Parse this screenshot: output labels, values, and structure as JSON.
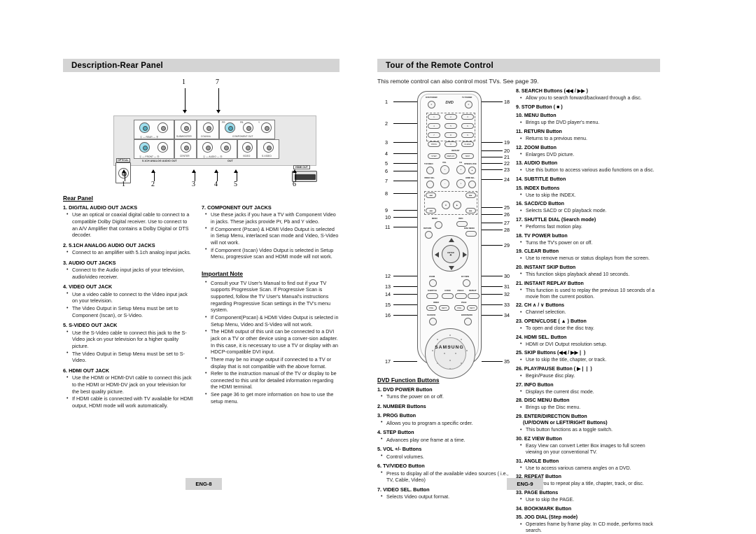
{
  "left_page": {
    "section_title": "Description-Rear Panel",
    "figure": {
      "top_callouts": [
        "1",
        "7"
      ],
      "bottom_callouts": [
        "1",
        "2",
        "3",
        "4",
        "5",
        "6"
      ],
      "panel_labels": {
        "optical": "OPTICAL",
        "rear": "Ⓛ — REAR — Ⓡ",
        "subwoofer": "SUBWOOFER",
        "coaxial": "COAXIAL",
        "component_out": "COMPONENT OUT",
        "component_pr": "PR",
        "component_pb": "PB",
        "component_y": "Y",
        "front": "Ⓛ — FRONT — Ⓡ",
        "center": "CENTER",
        "audio": "Ⓛ — AUDIO — Ⓡ",
        "video": "VIDEO",
        "svideo": "S-VIDEO",
        "analog_out": "5.1CH ANALOG AUDIO OUT",
        "out": "OUT",
        "hdmi_out": "HDMI OUT"
      }
    },
    "col1": {
      "heading": "Rear Panel",
      "items": [
        {
          "head": "1. DIGITAL AUDIO OUT JACKS",
          "bullets": [
            "Use an optical or coaxial digital cable to connect to a compatible Dolby Digital receiver. Use to connect to an A/V Amplifier that contains a Dolby Digital or DTS decoder."
          ]
        },
        {
          "head": "2. 5.1CH ANALOG AUDIO OUT JACKS",
          "bullets": [
            "Connect to an amplifier with 5.1ch analog input jacks."
          ]
        },
        {
          "head": "3. AUDIO OUT JACKS",
          "bullets": [
            "Connect to the Audio input jacks of your television, audio/video receiver."
          ]
        },
        {
          "head": "4. VIDEO OUT JACK",
          "bullets": [
            "Use a video cable to connect to the Video input jack on your television.",
            "The Video Output in Setup Menu must be set to Component (Iscan),  or S-Video."
          ]
        },
        {
          "head": "5. S-VIDEO OUT JACK",
          "bullets": [
            "Use the S-Video cable to connect this jack to the S-Video jack on your television for a higher quality picture.",
            "The Video Output in Setup Menu must be set to S-Video."
          ]
        },
        {
          "head": "6. HDMI OUT JACK",
          "bullets": [
            "Use the HDMI or HDMI-DVI cable to connect this jack to the HDMI or HDMI-DV jack on your television for the best quality picture.",
            "If HDMI cable is connected with TV available for HDMI output, HDMI mode will work automatically."
          ]
        }
      ]
    },
    "col2": {
      "items": [
        {
          "head": "7. COMPONENT OUT JACKS",
          "bullets": [
            "Use these jacks if you have a TV with Component Video in jacks. These jacks provide Pr, Pb and Y video.",
            "If Component (Pscan) & HDMI Video Output is selected in Setup Menu, interlaced scan mode and Video, S-Video will not work.",
            "If Component (Iscan) Video Output is selected in Setup Menu, progressive scan and HDMI mode will not work."
          ]
        }
      ],
      "note_heading": "Important Note",
      "note_bullets": [
        "Consult your TV User's Manual to find out if your TV supports Progressive Scan. If Progressive Scan is supported, follow the TV User's Manual's instructions regarding Progressive Scan settings in the TV's menu system.",
        "If Component(Pscan) & HDMI Video Output is selected in Setup Menu, Video and S-Video will not work.",
        "The HDMI output of this unit can be connected to a DVI jack on a TV or other device using a conver-sion adapter. In this case, it is necessary to use a TV or display with an HDCP-compatible DVI input.",
        "There may be no image output if connected to a TV or display that is not compatible with the above format.",
        "Refer to the instruction manual of the TV or display to be connected to this unit for detailed information regarding the HDMI terminal.",
        "See page 36 to get more information on how to use the setup menu."
      ]
    },
    "footer": "ENG-8"
  },
  "right_page": {
    "section_title": "Tour of the Remote Control",
    "intro": "This remote control can also control most TVs. See page 39.",
    "remote": {
      "brand": "SAMSUNG",
      "disc_logo": "DVD",
      "left_numbers": [
        "1",
        "2",
        "3",
        "4",
        "5",
        "6",
        "7",
        "8",
        "9",
        "10",
        "11",
        "12",
        "13",
        "14",
        "15",
        "16",
        "17"
      ],
      "right_numbers": [
        "18",
        "19",
        "20",
        "21",
        "22",
        "23",
        "24",
        "25",
        "26",
        "27",
        "28",
        "29",
        "30",
        "31",
        "32",
        "33",
        "34",
        "35"
      ],
      "button_labels": {
        "dvd_power": "DVD POWER",
        "tv_power": "TV POWER",
        "prog": "PROG",
        "clear": "CLEAR",
        "step": "STEP",
        "instant": "INSTANT",
        "replay": "REPLAY",
        "skip": "SKIP",
        "tv_video": "TV/VIDEO",
        "video_sel": "VIDEO SEL.",
        "vol": "VOL",
        "ch": "CH",
        "open_close": "OPEN/CLOSE",
        "hdmi_sel": "HDMI SEL.",
        "menu": "MENU",
        "info": "INFO",
        "return": "RETURN",
        "disc_menu": "DISC MENU",
        "enter": "ENTER",
        "zoom": "ZOOM",
        "ez_view": "EZ VIEW",
        "subtitle": "SUBTITLE",
        "audio": "AUDIO",
        "angle": "ANGLE",
        "repeat": "REPEAT",
        "index": "INDEX",
        "page": "PAGE",
        "prev": "PRE.",
        "next": "NEXT",
        "sacd": "SACD/CD",
        "bookmark": "BOOKMARK",
        "numbers": [
          "1",
          "2",
          "3",
          "4",
          "5",
          "6",
          "7",
          "8",
          "9",
          "0"
        ]
      }
    },
    "dvd_function": {
      "heading": "DVD Function Buttons",
      "items": [
        {
          "head": "1. DVD POWER Button",
          "bullets": [
            "Turns the power on or off."
          ]
        },
        {
          "head": "2. NUMBER Buttons",
          "bullets": []
        },
        {
          "head": "3. PROG Button",
          "bullets": [
            "Allows you to program a specific order."
          ]
        },
        {
          "head": "4. STEP Button",
          "bullets": [
            "Advances play one frame at a time."
          ]
        },
        {
          "head": "5. VOL +/- Buttons",
          "bullets": [
            "Control volumes."
          ]
        },
        {
          "head": "6. TV/VIDEO Button",
          "bullets": [
            "Press to display all of the available video sources ( i.e., TV, Cable, Video)"
          ]
        },
        {
          "head": "7. VIDEO SEL. Button",
          "bullets": [
            "Selects Video output format."
          ]
        }
      ]
    },
    "remote_list": {
      "items": [
        {
          "head": "8. SEARCH Buttons (◀◀ / ▶▶ )",
          "bullets": [
            "Allow you to search forward/backward through a disc."
          ]
        },
        {
          "head": "9. STOP Button ( ■ )",
          "bullets": []
        },
        {
          "head": "10. MENU Button",
          "bullets": [
            "Brings up the DVD player's menu."
          ]
        },
        {
          "head": "11. RETURN Button",
          "bullets": [
            "Returns to a previous menu."
          ]
        },
        {
          "head": "12. ZOOM Button",
          "bullets": [
            "Enlarges DVD picture."
          ]
        },
        {
          "head": "13. AUDIO Button",
          "bullets": [
            "Use this button to access various audio functions on a disc."
          ]
        },
        {
          "head": "14. SUBTITLE Button",
          "bullets": []
        },
        {
          "head": "15. INDEX Buttons",
          "bullets": [
            "Use to skip the INDEX."
          ]
        },
        {
          "head": "16. SACD/CD Button",
          "bullets": [
            "Selects SACD or CD playback mode."
          ]
        },
        {
          "head": "17. SHUTTLE DIAL (Search mode)",
          "bullets": [
            "Performs fast motion play."
          ]
        },
        {
          "head": "18. TV POWER button",
          "bullets": [
            "Turns the TV's power on or off."
          ]
        },
        {
          "head": "19. CLEAR Button",
          "bullets": [
            "Use to remove menus or status displays from the screen."
          ]
        },
        {
          "head": "20. INSTANT SKIP Button",
          "bullets": [
            "This function skips playback ahead 10 seconds."
          ]
        },
        {
          "head": "21. INSTANT REPLAY Button",
          "bullets": [
            "This function is used to replay the previous 10 seconds of a movie from the current position."
          ]
        },
        {
          "head": "22. CH ∧ / ∨ Buttons",
          "bullets": [
            "Channel selection."
          ]
        },
        {
          "head": "23. OPEN/CLOSE ( ▲ ) Button",
          "bullets": [
            "To open and close the disc tray."
          ]
        },
        {
          "head": "24. HDMI SEL. Button",
          "bullets": [
            "HDMI or DVI Output resolution setup."
          ]
        },
        {
          "head": "25. SKIP Buttons (◀◀ / ▶▶❘ )",
          "bullets": [
            "Use to skip the title, chapter, or track."
          ]
        },
        {
          "head": "26. PLAY/PAUSE Button ( ▶❘❘ )",
          "bullets": [
            "Begin/Pause disc play."
          ]
        },
        {
          "head": "27. INFO Button",
          "bullets": [
            "Displays the current disc mode."
          ]
        },
        {
          "head": "28. DISC MENU Button",
          "bullets": [
            "Brings up the Disc menu."
          ]
        },
        {
          "head": "29. ENTER/DIRECTION Button",
          "sub": "(UP/DOWN or LEFT/RIGHT Buttons)",
          "bullets": [
            "This button functions as a toggle switch."
          ]
        },
        {
          "head": "30. EZ VIEW Button",
          "bullets": [
            "Easy View can convert Letter Box images to full screen viewing on your conventional TV."
          ]
        },
        {
          "head": "31. ANGLE Button",
          "bullets": [
            "Use to access various camera angles on a DVD."
          ]
        },
        {
          "head": "32. REPEAT Button",
          "bullets": [
            "Allows you to repeat play a title, chapter, track, or disc."
          ]
        },
        {
          "head": "33. PAGE Buttons",
          "bullets": [
            "Use to skip the PAGE."
          ]
        },
        {
          "head": "34. BOOKMARK Button",
          "bullets": []
        },
        {
          "head": "35. JOG DIAL (Step mode)",
          "bullets": [
            "Operates frame by frame play. In CD mode, performs track search."
          ]
        }
      ]
    },
    "footer": "ENG-9"
  }
}
